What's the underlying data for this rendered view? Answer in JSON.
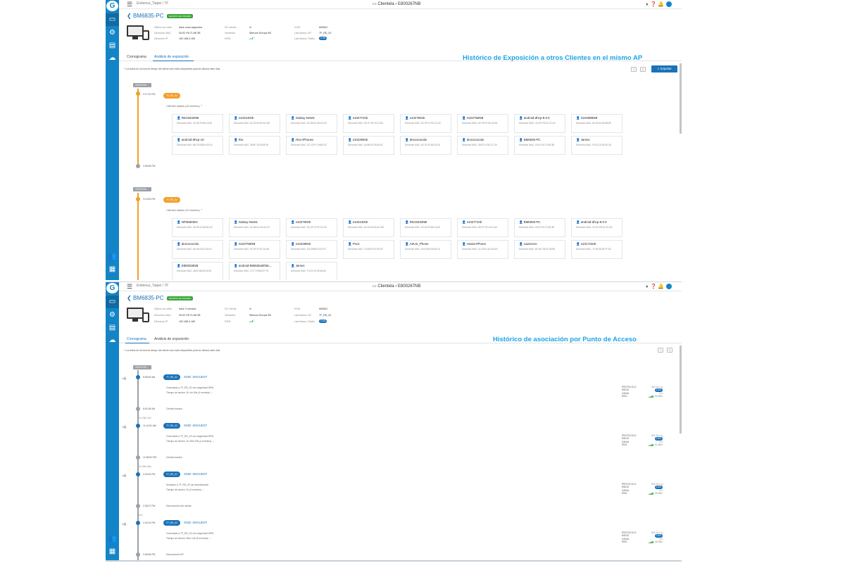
{
  "common": {
    "breadcrumb": "Entienus_Taipei / 7F",
    "window_title": "Clientela › E800267NB",
    "device_name": "BM6835-PC",
    "trial_badge": "VERSIÓN DE PRUEBA",
    "labels": {
      "last_seen": "Última vez visto",
      "mac": "Dirección MAC",
      "ip": "Dirección IP",
      "os": "SO cliente",
      "vendor": "Vendedor",
      "rssi": "RSSI",
      "ssid": "SSID",
      "last_ap": "Last Assoc. AP",
      "last_radio": "Last Assoc. Radio"
    },
    "values": {
      "mac": "00:0C:F6:71:6E:3B",
      "ip": "192.168.0.165",
      "vendor": "Sitecom Europe BV",
      "ssid": "MISMO",
      "last_ap": "7F_RD_02",
      "last_radio": "2.4G"
    },
    "tabs": [
      "Cronograma",
      "Análisis de exposición"
    ],
    "note": "* Los datos de la línea de tiempo del cliente solo están disponibles para los últimos siete días.",
    "mac_label": "Dirección MAC:",
    "colors": {
      "sidebar": "#1385c6",
      "accent": "#1a72b8",
      "overlay_title": "#1da4e3",
      "ap_pill": "#f0a02a"
    }
  },
  "screen1": {
    "last_seen_value": "hace unos segundos",
    "overlay_title": "Histórico de Exposición a otros Clientes en el mismo AP",
    "export_label": "Exportar",
    "groups": [
      {
        "date": "2020/07/09",
        "time_start": "2:27:10 PM",
        "time_end": "2:56:48 PM",
        "ap": "7F_RD_02",
        "clients_label": "Clientes totales (16 clientes)",
        "clients": [
          {
            "name": "RD16332NB",
            "mac": "3C:A9:F4:8A:18:20"
          },
          {
            "name": "s102440nb",
            "mac": "AC:54:15:69:AC:D8"
          },
          {
            "name": "Galaxy-Note5",
            "mac": "AC:86:41:0D:AC:E2"
          },
          {
            "name": "s102772nb",
            "mac": "DE:37:78:10:C4:44"
          },
          {
            "name": "s102760nb",
            "mac": "5C:3F:07:9C:C4:4C"
          },
          {
            "name": "S102755NB",
            "mac": "5C:3F:97:9C:A4:46"
          },
          {
            "name": "android-dhcp-8.0.0",
            "mac": "4C:EC:FB:31:2C:A3"
          },
          {
            "name": "S102886NB",
            "mac": "8C:52:30:A6:0B:5F"
          },
          {
            "name": "android-dhcp-10",
            "mac": "B8:7B:D8:54:34:D3"
          },
          {
            "name": "Rio",
            "mac": "08:8F:78:78:8E:0F"
          },
          {
            "name": "Alex-iPhonex",
            "mac": "3C:22:FF:18:5E:DC"
          },
          {
            "name": "s102299nb",
            "mac": "A4:85:00:78:6D:02"
          },
          {
            "name": "desconocido",
            "mac": "5C:37:92:8A:32:D4"
          },
          {
            "name": "desconocido",
            "mac": "38:E3:74:9C:C1:10"
          },
          {
            "name": "BM6835-PC",
            "mac": "00:0C:F6:71:6E:3B"
          },
          {
            "name": "James",
            "mac": "F4:31:C3:4E:8C:81"
          }
        ]
      },
      {
        "date": "2020/07/09",
        "time_start": "3:14:53 PM",
        "ap": "7F_RD_02",
        "clients_label": "Clientes totales (19 clientes)",
        "clients": [
          {
            "name": "NPI6683DC",
            "mac": "3A:0E:0C:68:81:DC"
          },
          {
            "name": "Galaxy-Note5",
            "mac": "AC:86:41:0D:AC:E2"
          },
          {
            "name": "s102760nb",
            "mac": "5C:3F:07:9C:C4:4C"
          },
          {
            "name": "s102440nb",
            "mac": "AC:54:15:69:AC:D8"
          },
          {
            "name": "RD16332NB",
            "mac": "3C:A9:F4:8A:18:20"
          },
          {
            "name": "s102772nb",
            "mac": "DE:37:78:10:C4:44"
          },
          {
            "name": "BM6835-PC",
            "mac": "00:0C:F6:71:6E:3B"
          },
          {
            "name": "android-dhcp-8.0.0",
            "mac": "4C:EC:FB:31:2C:A3"
          },
          {
            "name": "desconocido",
            "mac": "8A:46:CB:31:61:6C"
          },
          {
            "name": "S102755NB",
            "mac": "5C:3F:97:9C:A4:46"
          },
          {
            "name": "s102489nb",
            "mac": "D4:25:8B:03:31:FC"
          },
          {
            "name": "Pooz",
            "mac": "70:48:0F:61:0D:29"
          },
          {
            "name": "ASUS_Phone",
            "mac": "04:D0:50:09:AA:10"
          },
          {
            "name": "Howie-iPhone",
            "mac": "2C:33:61:A2:AA:EC"
          },
          {
            "name": "Lawrence",
            "mac": "BC:6D:7B:E2:36:88"
          },
          {
            "name": "s101716nb",
            "mac": "70:7B:35:08:7F:DC"
          },
          {
            "name": "E800026NB",
            "mac": "48:02:68:A2:81:83"
          },
          {
            "name": "android-9869d2a0f45c...",
            "mac": "10:77:F8:B2:07:75"
          },
          {
            "name": "James",
            "mac": "F4:31:C3:4E:8A:81"
          }
        ]
      }
    ]
  },
  "screen2": {
    "last_seen_value": "hace 3 minutos",
    "overlay_title": "Histórico de asociación por Punto de Acceso",
    "stats_labels": [
      "PROTOCOLO",
      "RADIO",
      "CANAL",
      "RSSI"
    ],
    "events": [
      {
        "date": "2020/07/09",
        "time": "8:56:49 AM",
        "ap": "7F_RD_02",
        "ssid": "SSID: SNGUEST",
        "desc": "Conectado a 7F_RD_02 con seguridad WPA",
        "session": "Tiempo de sesión: 1h 4m 54s (4 eventos) ⌄",
        "end_time": "8:51:36 AM",
        "end_label": "Cliente inactivo",
        "gap": "1h 23m 12s",
        "protocol": "802.11n / g",
        "radio": "2.4G",
        "channel": "4.4",
        "rssi": "-55 dBm"
      },
      {
        "time": "11:14:51 AM",
        "ap": "7F_RD_02",
        "ssid": "SSID: SNGUEST",
        "desc": "Conectado a 7F_RD_02 con seguridad WPA",
        "session": "Tiempo de sesión: 1h 45m 29s (4 eventos) ⌄",
        "end_time": "12:58:30 PM",
        "end_label": "Cliente inactivo",
        "gap": "1h 30m 55s",
        "protocol": "802.11n / g",
        "radio": "2.4G",
        "channel": "4.4",
        "rssi": "-61 dBm"
      },
      {
        "time": "2:26:25 PM",
        "ap": "7F_RD_02",
        "ssid": "SSID: SNGUEST",
        "desc": "Asociado a 7F_RD_02 sin autenticación",
        "session": "Tiempo de sesión: 2s (3 eventos) ⌄",
        "end_time": "2:28:27 PM",
        "end_label": "Desconexión del cliente",
        "gap": "57s",
        "protocol": "802.11n / g",
        "radio": "2.4G",
        "channel": "4.4",
        "rssi": "-55 dBm"
      },
      {
        "time": "2:42:24 PM",
        "ap": "7F_RD_02",
        "ssid": "SSID: SNGUEST",
        "desc": "Conectado a 7F_RD_02 con seguridad WPA",
        "session": "Tiempo de sesión: 56m 14s (5 eventos) ⌄",
        "end_time": "3:36:38 PM",
        "end_label": "Desconexión AP",
        "protocol": "802.11n / g",
        "radio": "2.4G",
        "channel": "4.4",
        "rssi": "-55 dBm"
      }
    ]
  }
}
